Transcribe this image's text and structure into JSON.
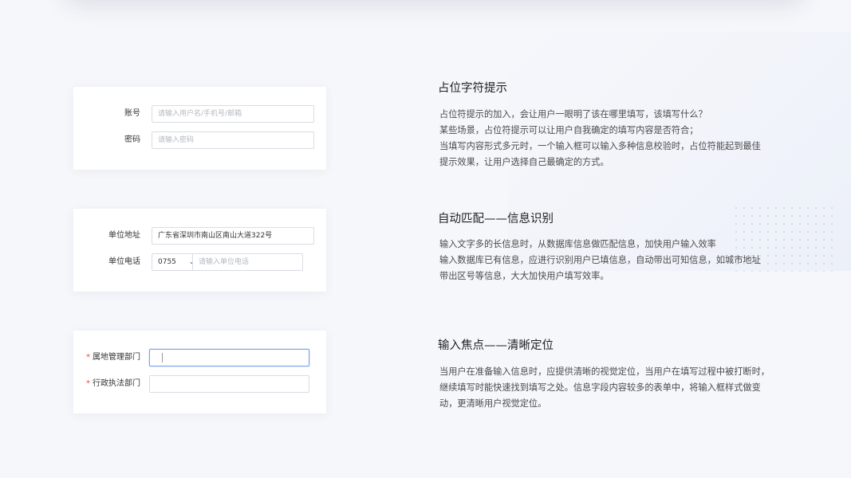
{
  "cards": [
    {
      "rows": [
        {
          "label": "账号",
          "placeholder": "请输入用户名/手机号/邮箱"
        },
        {
          "label": "密码",
          "placeholder": "请输入密码"
        }
      ]
    },
    {
      "rows": [
        {
          "label": "单位地址",
          "value": "广东省深圳市南山区南山大道322号"
        },
        {
          "label": "单位电话",
          "select_value": "0755",
          "placeholder": "请输入单位电话"
        }
      ]
    },
    {
      "rows": [
        {
          "required": "*",
          "label": "属地管理部门",
          "value": ""
        },
        {
          "required": "*",
          "label": "行政执法部门",
          "value": ""
        }
      ]
    }
  ],
  "sections": [
    {
      "title": "占位字符提示",
      "lines": [
        "占位符提示的加入，会让用户一眼明了该在哪里填写，该填写什么？",
        "某些场景，占位符提示可以让用户自我确定的填写内容是否符合；",
        "当填写内容形式多元时，一个输入框可以输入多种信息校验时，占位符能起到最佳",
        "提示效果，让用户选择自己最确定的方式。"
      ]
    },
    {
      "title": "自动匹配——信息识别",
      "lines": [
        "输入文字多的长信息时，从数据库信息做匹配信息，加快用户输入效率",
        "输入数据库已有信息，应进行识别用户已填信息，自动带出可知信息，如城市地址",
        "带出区号等信息，大大加快用户填写效率。"
      ]
    },
    {
      "title": "输入焦点——清晰定位",
      "lines": [
        "当用户在准备输入信息时，应提供清晰的视觉定位，当用户在填写过程中被打断时，",
        "继续填写时能快速找到填写之处。信息字段内容较多的表单中，将输入框样式做变",
        "动，更清晰用户视觉定位。"
      ]
    }
  ]
}
